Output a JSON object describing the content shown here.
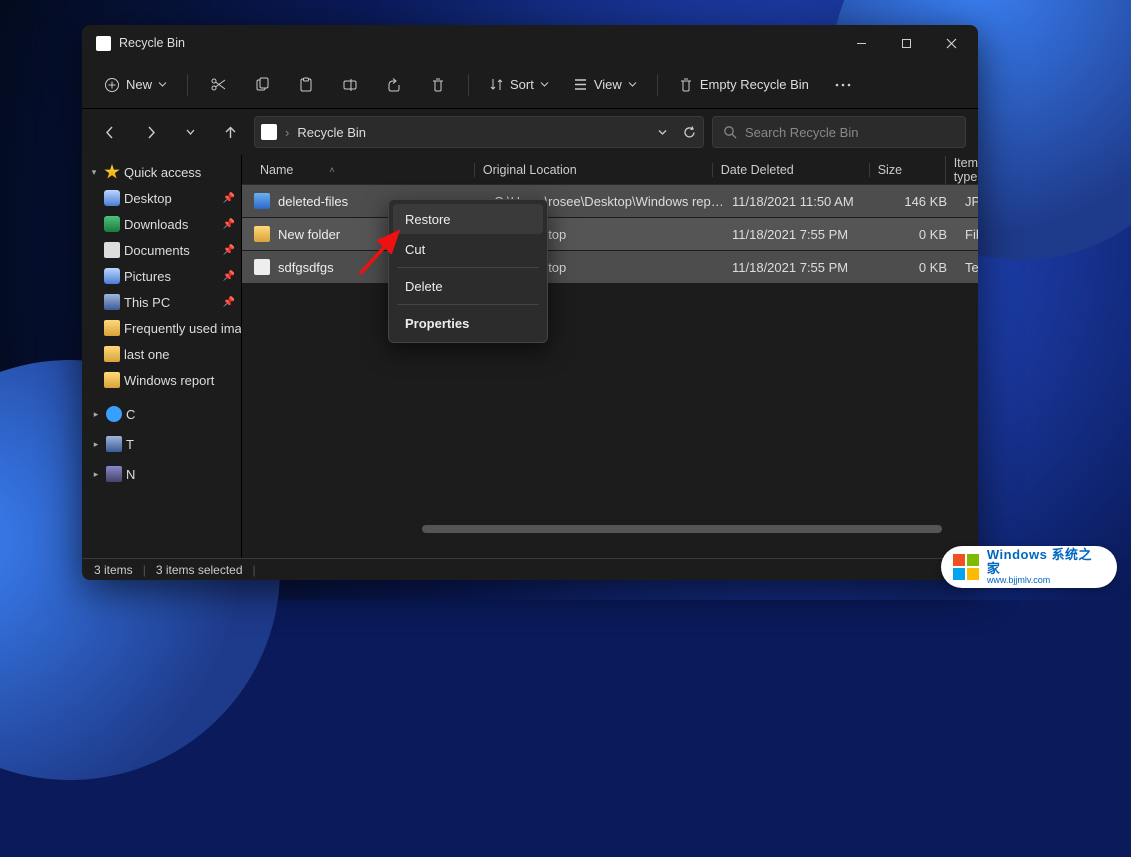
{
  "window": {
    "title": "Recycle Bin"
  },
  "toolbar": {
    "new": "New",
    "sort": "Sort",
    "view": "View",
    "empty": "Empty Recycle Bin"
  },
  "address": {
    "crumb": "Recycle Bin",
    "search_placeholder": "Search Recycle Bin"
  },
  "sidebar": {
    "quick": "Quick access",
    "items": [
      {
        "label": "Desktop",
        "pinned": true,
        "icon": "disk"
      },
      {
        "label": "Downloads",
        "pinned": true,
        "icon": "disk"
      },
      {
        "label": "Documents",
        "pinned": true,
        "icon": "doc"
      },
      {
        "label": "Pictures",
        "pinned": true,
        "icon": "disk"
      },
      {
        "label": "This PC",
        "pinned": true,
        "icon": "pc"
      },
      {
        "label": "Frequently used images",
        "pinned": false,
        "icon": "folder"
      },
      {
        "label": "last one",
        "pinned": false,
        "icon": "folder"
      },
      {
        "label": "Windows report",
        "pinned": false,
        "icon": "folder"
      }
    ],
    "drives": [
      {
        "label": "C",
        "icon": "cloud"
      },
      {
        "label": "T",
        "icon": "pc"
      },
      {
        "label": "N",
        "icon": "net"
      }
    ]
  },
  "columns": {
    "name": "Name",
    "loc": "Original Location",
    "date": "Date Deleted",
    "size": "Size",
    "type": "Item type"
  },
  "rows": [
    {
      "name": "deleted-files",
      "loc": "C:\\Users\\rosee\\Desktop\\Windows report\\...",
      "date": "11/18/2021 11:50 AM",
      "size": "146 KB",
      "type": "JP",
      "icon": "img"
    },
    {
      "name": "New folder",
      "loc": "see\\Desktop",
      "date": "11/18/2021 7:55 PM",
      "size": "0 KB",
      "type": "Fil",
      "icon": "folder"
    },
    {
      "name": "sdfgsdfgs",
      "loc": "see\\Desktop",
      "date": "11/18/2021 7:55 PM",
      "size": "0 KB",
      "type": "Te",
      "icon": "txt"
    }
  ],
  "context": {
    "restore": "Restore",
    "cut": "Cut",
    "delete": "Delete",
    "properties": "Properties"
  },
  "status": {
    "count": "3 items",
    "selected": "3 items selected"
  },
  "watermark": {
    "line1": "Windows 系统之家",
    "line2": "www.bjjmlv.com"
  }
}
